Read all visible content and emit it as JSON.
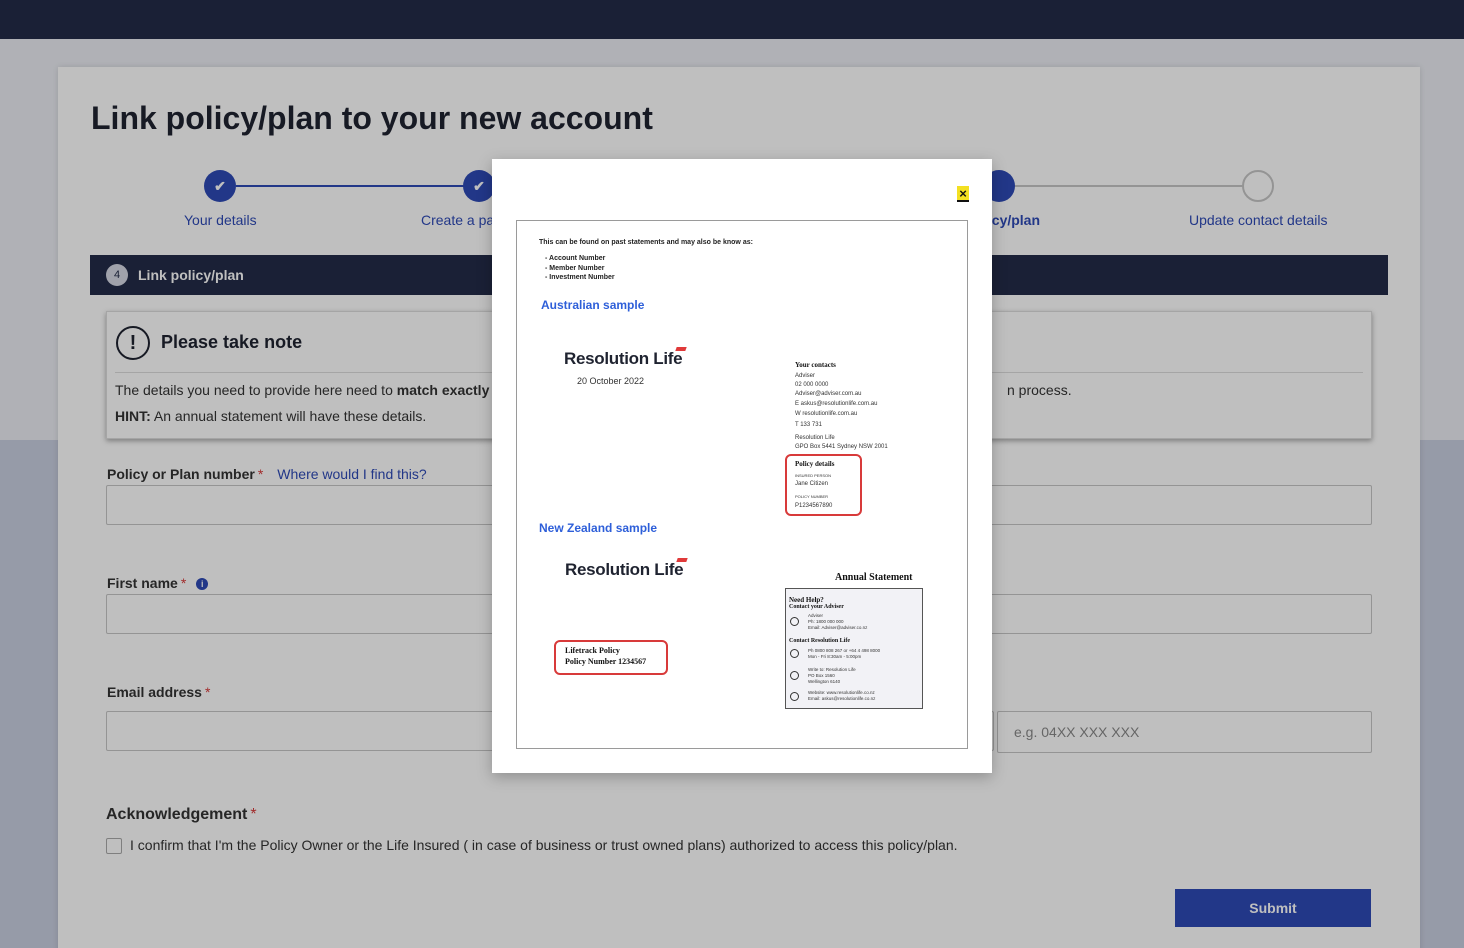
{
  "page": {
    "title": "Link policy/plan to your new account"
  },
  "stepper": {
    "steps": [
      {
        "label": "Your details",
        "state": "done"
      },
      {
        "label": "Create a pa",
        "state": "done"
      },
      {
        "label": "licy/plan",
        "state": "active"
      },
      {
        "label": "Update contact details",
        "state": "todo"
      }
    ],
    "check_glyph": "✔"
  },
  "section": {
    "number": "4",
    "title": "Link policy/plan"
  },
  "note": {
    "icon_glyph": "!",
    "title": "Please take note",
    "line1_prefix": "The details you need to provide here need to ",
    "line1_bold": "match exactly",
    "line1_tail": "n process.",
    "line2_bold": "HINT:",
    "line2_rest": " An annual statement will have these details."
  },
  "form": {
    "policy_label": "Policy or Plan number",
    "required_mark": "*",
    "find_link": "Where would I find this?",
    "first_name_label": "First name",
    "info_glyph": "i",
    "email_label": "Email address",
    "phone_placeholder": "e.g. 04XX XXX XXX"
  },
  "acknowledgement": {
    "title": "Acknowledgement",
    "text": "I confirm that I'm the Policy Owner or the Life Insured ( in case of business or trust owned plans) authorized to access this policy/plan."
  },
  "submit_label": "Submit",
  "modal": {
    "close_glyph": "×",
    "intro": "This can be found on past statements and may also be know as:",
    "aliases": [
      "- Account Number",
      "- Member Number",
      "- Investment Number"
    ],
    "au_heading": "Australian sample",
    "logo_text": "Resolution Life",
    "au_date": "20 October 2022",
    "contacts_title": "Your contacts",
    "contacts_lines": [
      "Adviser",
      "02 000 0000",
      "Adviser@adviser.com.au",
      "E  askus@resolutionlife.com.au",
      "W  resolutionlife.com.au",
      "T   133 731"
    ],
    "address_lines": [
      "Resolution Life",
      "GPO Box 5441 Sydney NSW 2001"
    ],
    "policy_details_title": "Policy details",
    "insured_label": "INSURED PERSON",
    "insured_name": "Jane Citizen",
    "policy_number_label": "POLICY NUMBER",
    "policy_number": "P1234567890",
    "nz_heading": "New Zealand sample",
    "annual_statement": "Annual Statement",
    "nz_policy_line1": "Lifetrack Policy",
    "nz_policy_line2": "Policy Number 1234567",
    "help_title": "Need Help?",
    "contact_adviser": "Contact your Adviser",
    "adviser_lines": [
      "Adviser",
      "Ph: 1800 000 000",
      "Email: Adviser@adviser.co.nz"
    ],
    "contact_rl": "Contact Resolution Life",
    "rl_phone_lines": [
      "Ph 0800 808 267 or +64 4 498 8000",
      "Mon - Fri 8:30am - 5:00pm"
    ],
    "rl_write_lines": [
      "Write to: Resolution Life",
      "PO Box 1560",
      "Wellington 6140"
    ],
    "rl_web_lines": [
      "Website: www.resolutionlife.co.nz",
      "Email: askus@resolutionlife.co.nz"
    ]
  },
  "colors": {
    "brand_navy": "#232b48",
    "accent_blue": "#2e4ab6",
    "required_red": "#d83a3a"
  }
}
